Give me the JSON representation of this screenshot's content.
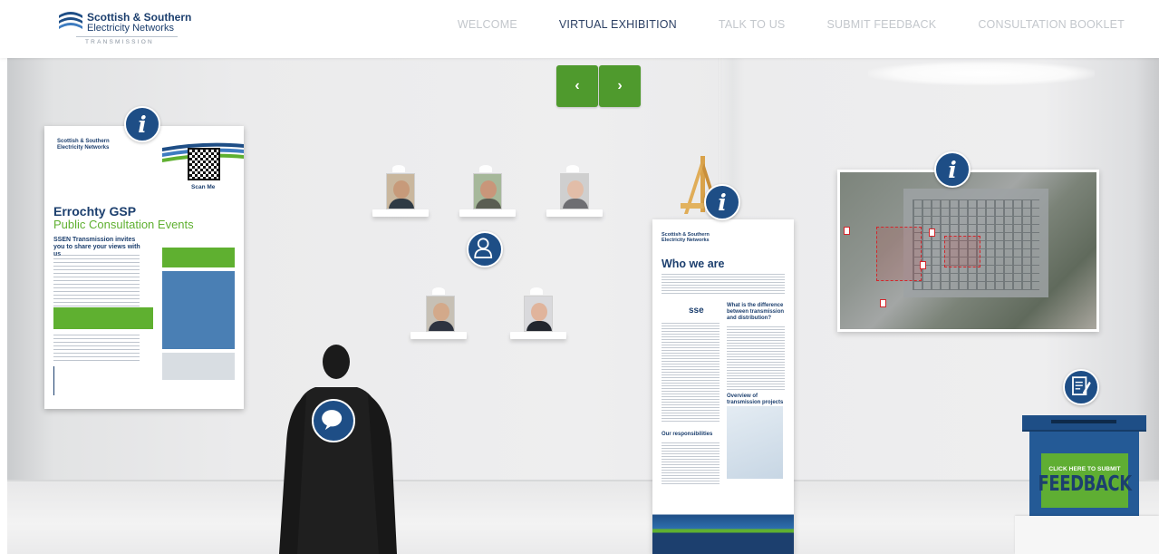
{
  "brand": {
    "name_line1": "Scottish & Southern",
    "name_line2": "Electricity Networks",
    "tagline": "TRANSMISSION"
  },
  "nav": {
    "items": [
      {
        "label": "WELCOME",
        "active": false
      },
      {
        "label": "VIRTUAL EXHIBITION",
        "active": true
      },
      {
        "label": "TALK TO US",
        "active": false
      },
      {
        "label": "SUBMIT FEEDBACK",
        "active": false
      },
      {
        "label": "CONSULTATION BOOKLET",
        "active": false
      }
    ]
  },
  "carousel": {
    "prev_label": "‹",
    "next_label": "›"
  },
  "poster": {
    "logo_line1": "Scottish & Southern",
    "logo_line2": "Electricity Networks",
    "scan_label": "Scan Me",
    "title_line1": "Errochty GSP",
    "title_line2": "Public Consultation Events",
    "heading": "SSEN Transmission invites you to share your views with us"
  },
  "banner": {
    "logo_line1": "Scottish & Southern",
    "logo_line2": "Electricity Networks",
    "title": "Who we are",
    "sse_label": "sse",
    "subheading_1": "What is the difference between transmission and distribution?",
    "subheading_2": "Overview of transmission projects",
    "subheading_3": "Our responsibilities"
  },
  "feedback": {
    "small_label": "CLICK HERE TO SUBMIT",
    "big_label": "FEEDBACK"
  },
  "icons": {
    "info": "i",
    "info_glyph_name": "info-icon",
    "person_glyph_name": "person-icon",
    "chat_glyph_name": "chat-bubble-icon",
    "feedback_glyph_name": "feedback-form-icon"
  },
  "colors": {
    "brand_navy": "#1e4e86",
    "accent_green": "#4f9a2d",
    "nav_active": "#2b3f63",
    "nav_inactive": "#c3c7cc"
  }
}
